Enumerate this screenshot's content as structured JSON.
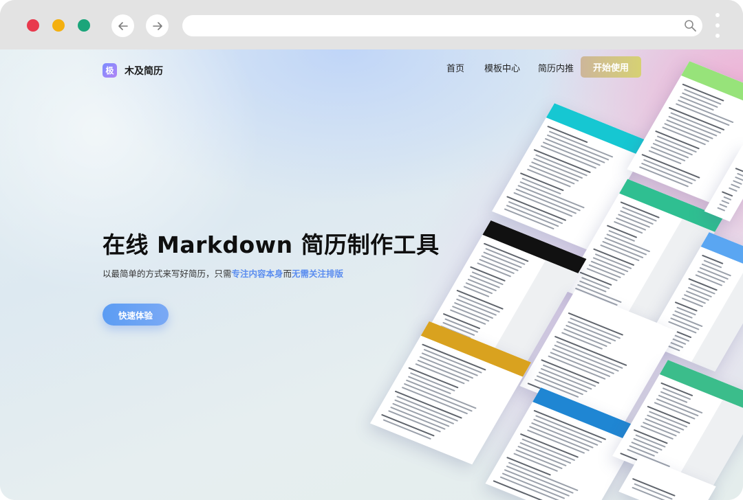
{
  "site": {
    "brand_logo_char": "极",
    "brand_name": "木及简历",
    "nav": [
      {
        "label": "首页"
      },
      {
        "label": "模板中心"
      },
      {
        "label": "简历内推"
      }
    ],
    "cta_top": "开始使用"
  },
  "hero": {
    "title": "在线 Markdown 简历制作工具",
    "subtitle_part1": "以最简单的方式来写好简历，只需",
    "subtitle_highlight1": "专注内容本身",
    "subtitle_part2": "而",
    "subtitle_highlight2": "无需关注排版",
    "cta": "快速体验"
  },
  "browser": {
    "url_value": "",
    "icons": {
      "back": "arrow-left-icon",
      "forward": "arrow-right-icon",
      "search": "search-icon",
      "menu": "kebab-menu-icon"
    }
  },
  "colors": {
    "dot_red": "#e8394d",
    "dot_yellow": "#f4b010",
    "dot_green": "#1ba57a",
    "accent_blue": "#5b8def",
    "cta_top_gold": "#d6d173",
    "card_colors": [
      "#16c7d2",
      "#97e37a",
      "#2fbf91",
      "#111111",
      "#5aa6f2",
      "#d9a21f",
      "#1f86d3",
      "#3bbd8b",
      "#ffffff",
      "#ffffff",
      "#ffffff"
    ]
  }
}
